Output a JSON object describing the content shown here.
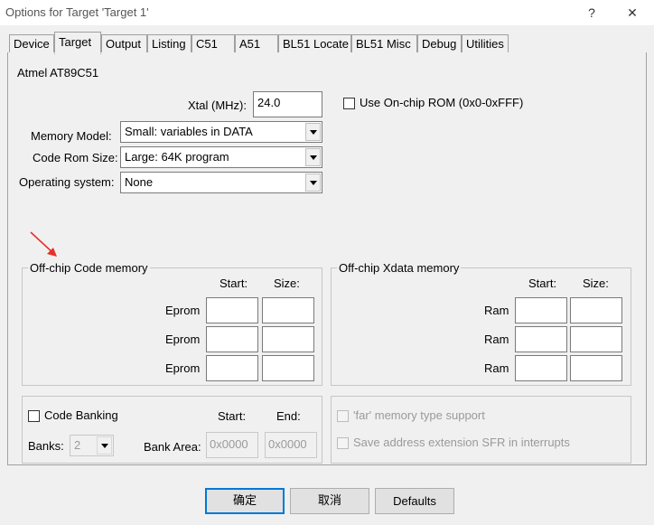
{
  "window": {
    "title": "Options for Target 'Target 1'",
    "help_label": "?",
    "close_label": "✕"
  },
  "tabs": [
    {
      "label": "Device"
    },
    {
      "label": "Target"
    },
    {
      "label": "Output"
    },
    {
      "label": "Listing"
    },
    {
      "label": "C51"
    },
    {
      "label": "A51"
    },
    {
      "label": "BL51 Locate"
    },
    {
      "label": "BL51 Misc"
    },
    {
      "label": "Debug"
    },
    {
      "label": "Utilities"
    }
  ],
  "active_tab": "Target",
  "device_name": "Atmel AT89C51",
  "xtal": {
    "label": "Xtal (MHz):",
    "value": "24.0"
  },
  "onchip_rom": {
    "label": "Use On-chip ROM (0x0-0xFFF)",
    "checked": false
  },
  "memory_model": {
    "label": "Memory Model:",
    "value": "Small: variables in DATA"
  },
  "code_rom_size": {
    "label": "Code Rom Size:",
    "value": "Large: 64K program"
  },
  "operating_system": {
    "label": "Operating system:",
    "value": "None"
  },
  "annotation_arrow_color": "#e8302a",
  "offchip_code": {
    "title": "Off-chip Code memory",
    "start_header": "Start:",
    "size_header": "Size:",
    "rows": [
      {
        "label": "Eprom",
        "start": "",
        "size": ""
      },
      {
        "label": "Eprom",
        "start": "",
        "size": ""
      },
      {
        "label": "Eprom",
        "start": "",
        "size": ""
      }
    ]
  },
  "offchip_xdata": {
    "title": "Off-chip Xdata memory",
    "start_header": "Start:",
    "size_header": "Size:",
    "rows": [
      {
        "label": "Ram",
        "start": "",
        "size": ""
      },
      {
        "label": "Ram",
        "start": "",
        "size": ""
      },
      {
        "label": "Ram",
        "start": "",
        "size": ""
      }
    ]
  },
  "code_banking": {
    "label": "Code Banking",
    "checked": false,
    "banks_label": "Banks:",
    "banks_value": "2",
    "start_header": "Start:",
    "end_header": "End:",
    "bank_area_label": "Bank Area:",
    "bank_start": "0x0000",
    "bank_end": "0x0000"
  },
  "far_memory": {
    "label": "'far' memory type support",
    "checked": false
  },
  "save_address": {
    "label": "Save address extension SFR in interrupts",
    "checked": false
  },
  "buttons": {
    "ok": "确定",
    "cancel": "取消",
    "defaults": "Defaults"
  }
}
